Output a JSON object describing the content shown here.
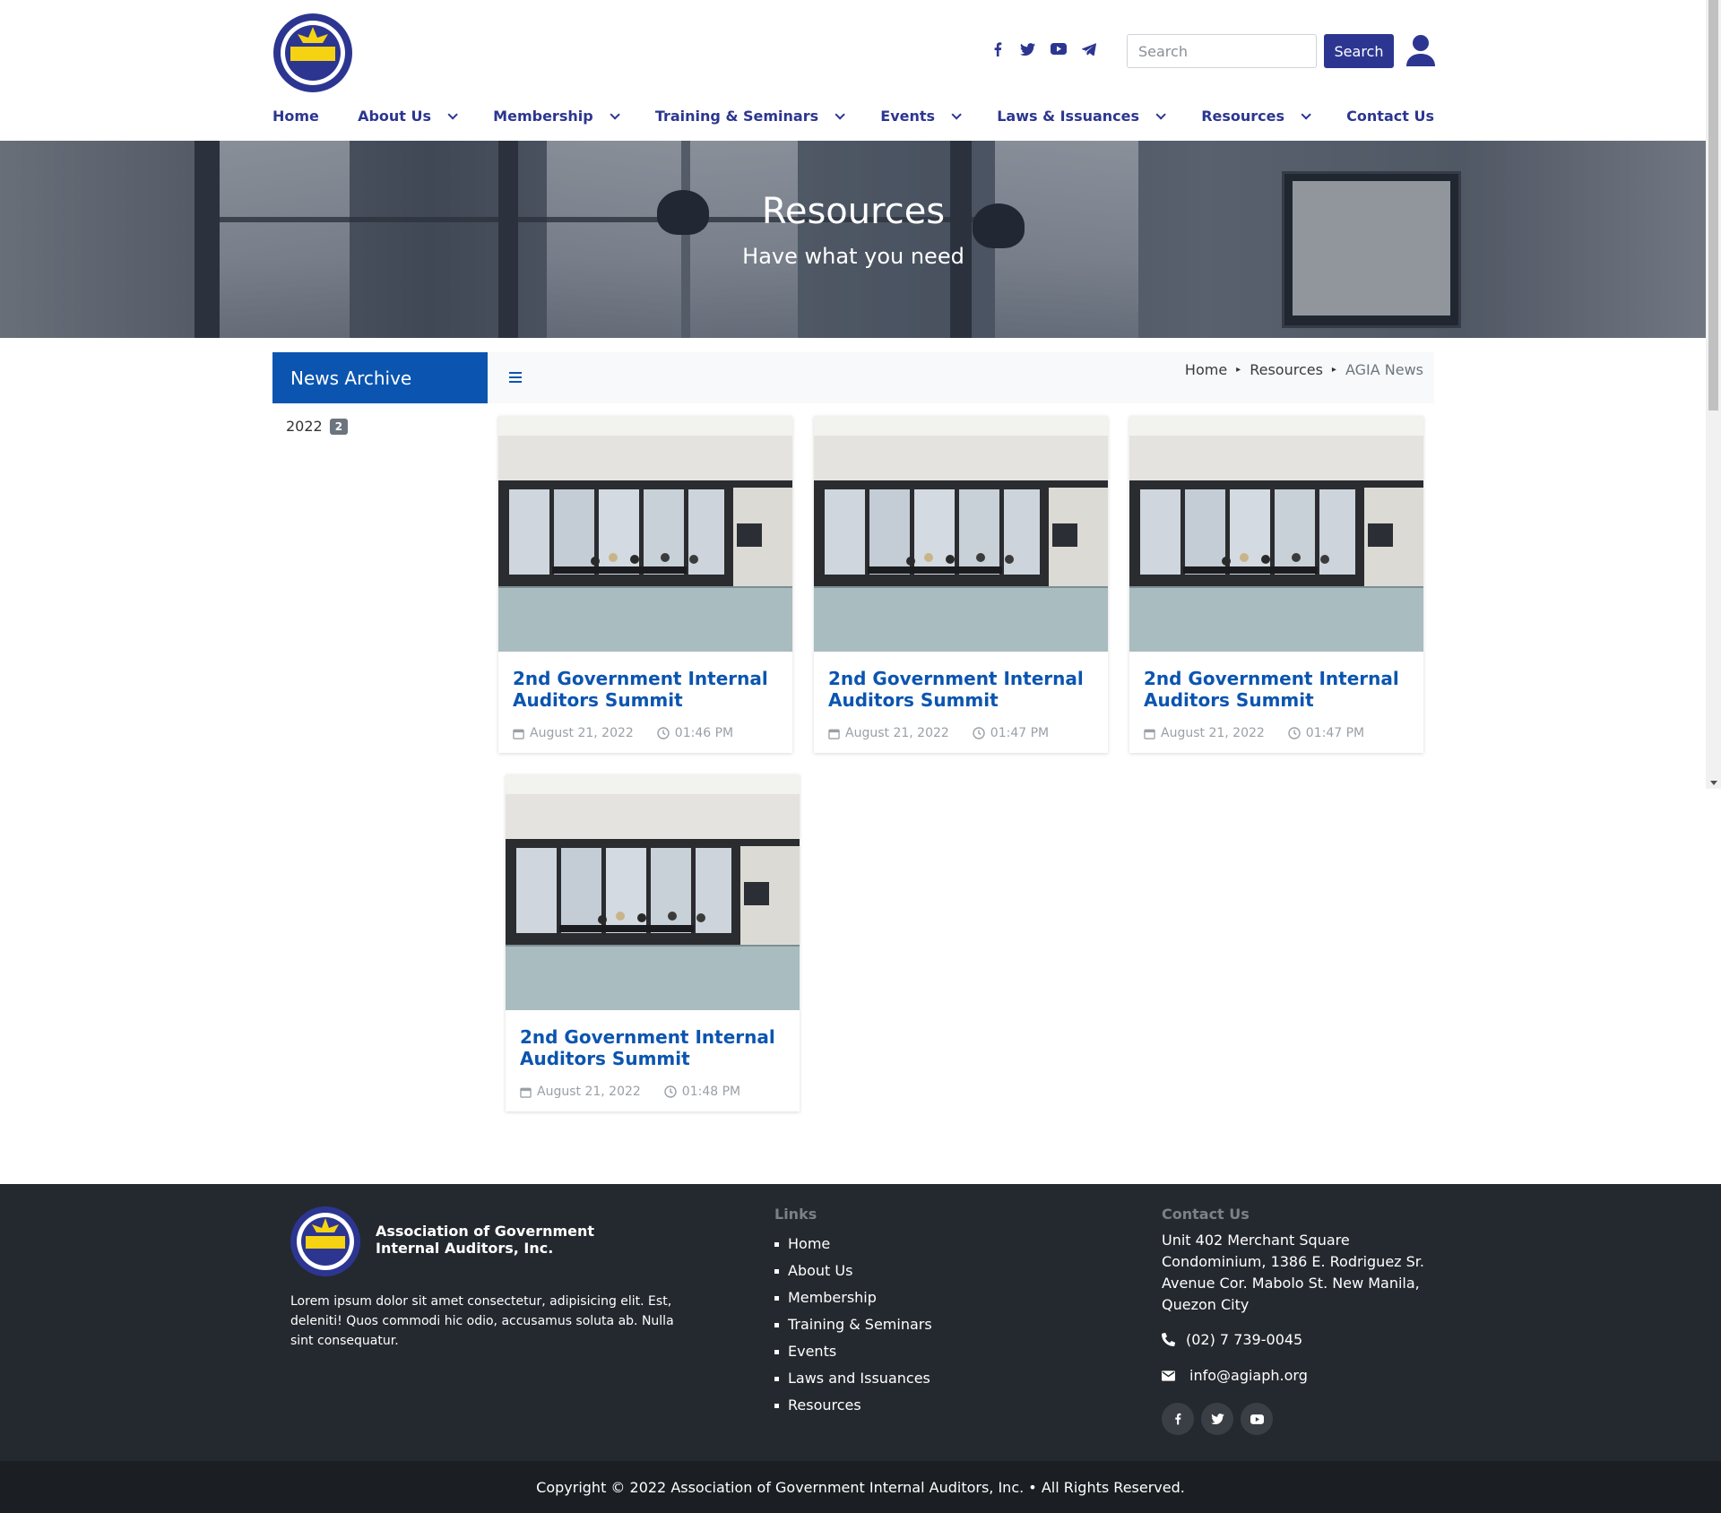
{
  "header": {
    "logo_alt": "AGIA",
    "social": [
      "facebook-icon",
      "twitter-icon",
      "youtube-icon",
      "telegram-icon"
    ],
    "search_placeholder": "Search",
    "search_button": "Search"
  },
  "nav": [
    {
      "label": "Home",
      "dropdown": false
    },
    {
      "label": "About Us",
      "dropdown": true
    },
    {
      "label": "Membership",
      "dropdown": true
    },
    {
      "label": "Training & Seminars",
      "dropdown": true
    },
    {
      "label": "Events",
      "dropdown": true
    },
    {
      "label": "Laws & Issuances",
      "dropdown": true
    },
    {
      "label": "Resources",
      "dropdown": true
    },
    {
      "label": "Contact Us",
      "dropdown": false
    }
  ],
  "hero": {
    "title": "Resources",
    "subtitle": "Have what you need"
  },
  "sidebar": {
    "title": "News Archive",
    "years": [
      {
        "year": "2022",
        "count": "2"
      }
    ]
  },
  "breadcrumb": [
    "Home",
    "Resources",
    "AGIA News"
  ],
  "posts": [
    {
      "title": "2nd Government Internal Auditors Summit",
      "date": "August 21, 2022",
      "time": "01:46 PM"
    },
    {
      "title": "2nd Government Internal Auditors Summit",
      "date": "August 21, 2022",
      "time": "01:47 PM"
    },
    {
      "title": "2nd Government Internal Auditors Summit",
      "date": "August 21, 2022",
      "time": "01:47 PM"
    },
    {
      "title": "2nd Government Internal Auditors Summit",
      "date": "August 21, 2022",
      "time": "01:48 PM"
    }
  ],
  "footer": {
    "org_name": "Association of Government Internal Auditors, Inc.",
    "description": "Lorem ipsum dolor sit amet consectetur, adipisicing elit. Est, deleniti! Quos commodi hic odio, accusamus soluta ab. Nulla sint consequatur.",
    "links_heading": "Links",
    "links": [
      "Home",
      "About Us",
      "Membership",
      "Training & Seminars",
      "Events",
      "Laws and Issuances",
      "Resources"
    ],
    "contact_heading": "Contact Us",
    "address": "Unit 402 Merchant Square Condominium, 1386 E. Rodriguez Sr. Avenue Cor. Mabolo St. New Manila, Quezon City",
    "phone": "(02) 7 739-0045",
    "email": "info@agiaph.org",
    "social": [
      "facebook-icon",
      "twitter-icon",
      "youtube-icon"
    ],
    "copyright": "Copyright © 2022 Association of Government Internal Auditors, Inc. • All Rights Reserved."
  },
  "colors": {
    "brand_navy": "#2c3691",
    "accent_blue": "#0b55b0",
    "footer_bg": "#24292f",
    "copyright_bg": "#1b1e22"
  }
}
